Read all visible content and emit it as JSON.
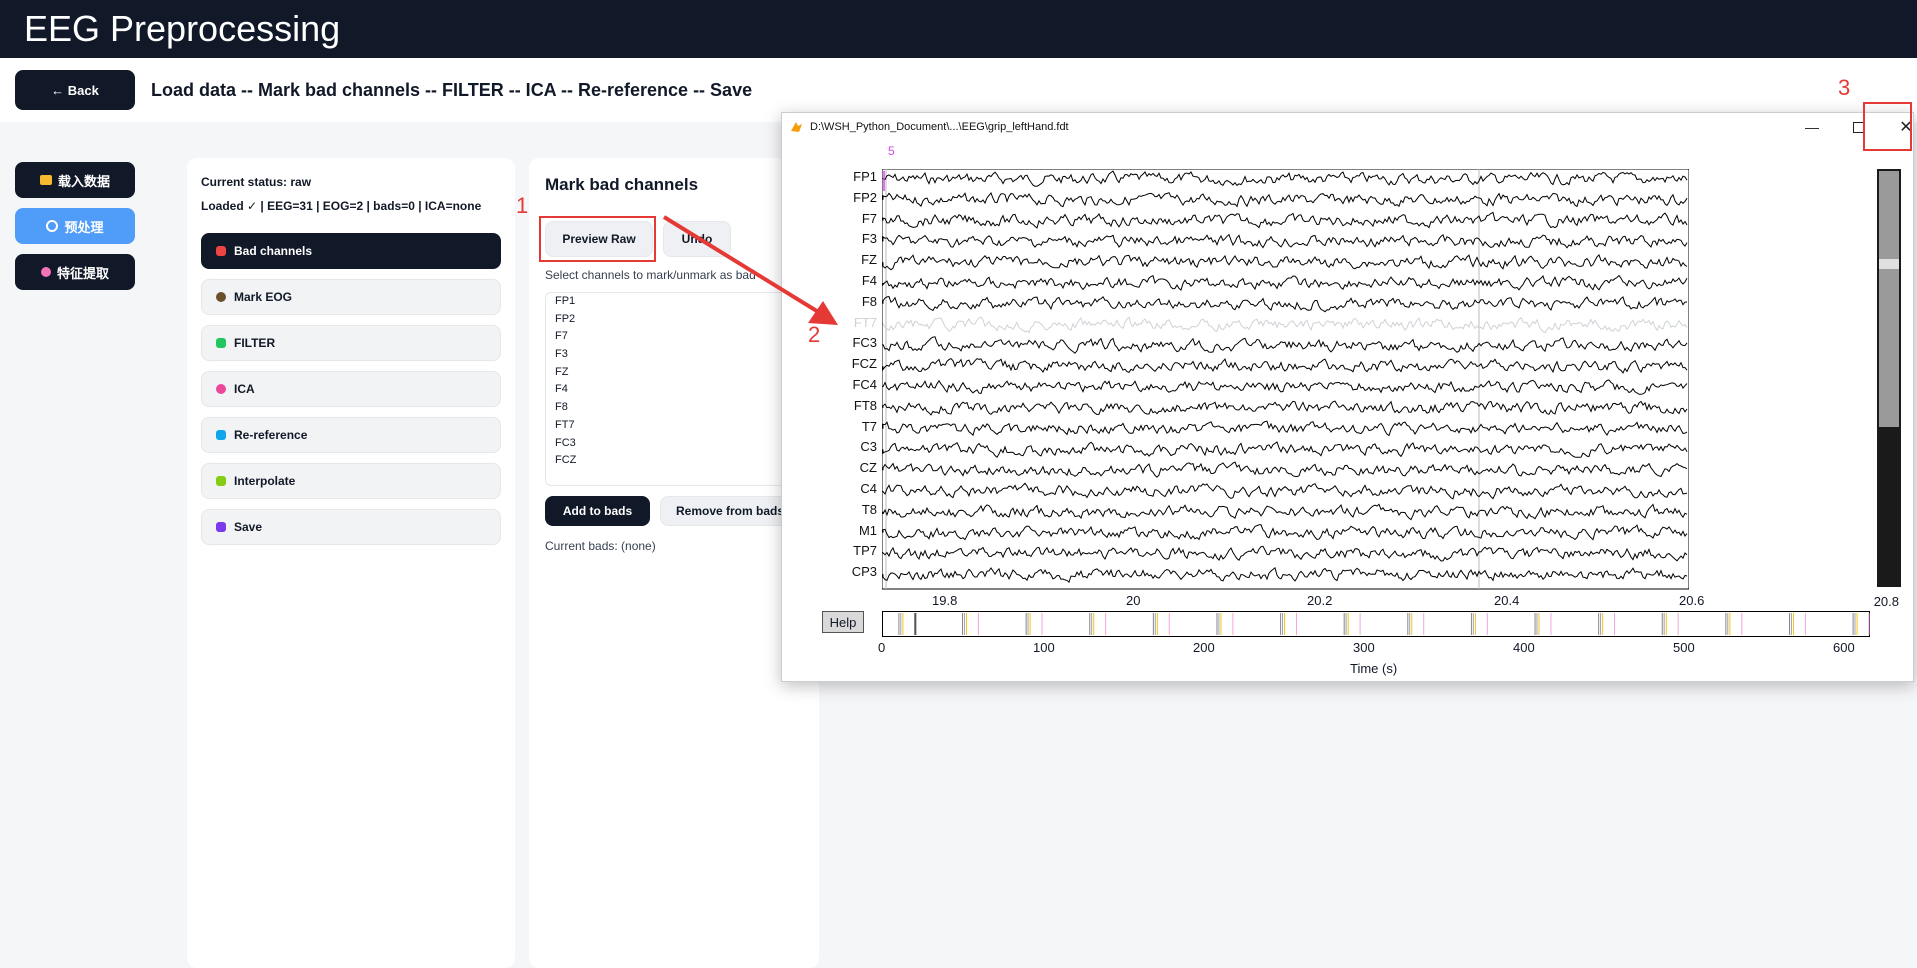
{
  "app": {
    "title": "EEG Preprocessing"
  },
  "header": {
    "back_label": "← Back",
    "steps": "Load data -- Mark bad channels -- FILTER -- ICA -- Re-reference -- Save"
  },
  "sidebar": {
    "items": [
      {
        "label": "载入数据",
        "icon": "folder-icon",
        "color": "#f5b82e"
      },
      {
        "label": "预处理",
        "icon": "gear-icon",
        "color": "#ffffff",
        "active": true
      },
      {
        "label": "特征提取",
        "icon": "palette-icon",
        "color": "#f472b6"
      }
    ]
  },
  "status": {
    "current": "Current status: raw",
    "loaded": "Loaded ✓ | EEG=31 | EOG=2 | bads=0 | ICA=none"
  },
  "steps": [
    {
      "label": "Bad channels",
      "icon": "chemistry-icon",
      "color": "#ef4444",
      "active": true
    },
    {
      "label": "Mark EOG",
      "icon": "eye-icon",
      "color": "#6b4f2a"
    },
    {
      "label": "FILTER",
      "icon": "pen-icon",
      "color": "#22c55e"
    },
    {
      "label": "ICA",
      "icon": "brain-icon",
      "color": "#ec4899"
    },
    {
      "label": "Re-reference",
      "icon": "repeat-icon",
      "color": "#0ea5e9"
    },
    {
      "label": "Interpolate",
      "icon": "puzzle-icon",
      "color": "#84cc16"
    },
    {
      "label": "Save",
      "icon": "floppy-icon",
      "color": "#7c3aed"
    }
  ],
  "bad_section": {
    "title": "Mark bad channels",
    "preview_label": "Preview Raw",
    "undo_label": "Undo",
    "hint": "Select channels to mark/unmark as bad",
    "channels": [
      "FP1",
      "FP2",
      "F7",
      "F3",
      "FZ",
      "F4",
      "F8",
      "FT7",
      "FC3",
      "FCZ"
    ],
    "add_label": "Add to bads",
    "remove_label": "Remove from bads",
    "current_bads": "Current bads: (none)"
  },
  "annotations": {
    "n1": "1",
    "n2": "2",
    "n3": "3"
  },
  "mne_window": {
    "title": "D:\\WSH_Python_Document\\...\\EEG\\grip_leftHand.fdt",
    "channels": [
      "FP1",
      "FP2",
      "F7",
      "F3",
      "FZ",
      "F4",
      "F8",
      "FT7",
      "FC3",
      "FCZ",
      "FC4",
      "FT8",
      "T7",
      "C3",
      "CZ",
      "C4",
      "T8",
      "M1",
      "TP7",
      "CP3"
    ],
    "bad_channel": "FT7",
    "scale_label": "5",
    "x_ticks": [
      "19.8",
      "20",
      "20.2",
      "20.4",
      "20.6",
      "20.8"
    ],
    "help_label": "Help",
    "overview_ticks": [
      "0",
      "100",
      "200",
      "300",
      "400",
      "500",
      "600"
    ],
    "xlabel": "Time (s)"
  }
}
